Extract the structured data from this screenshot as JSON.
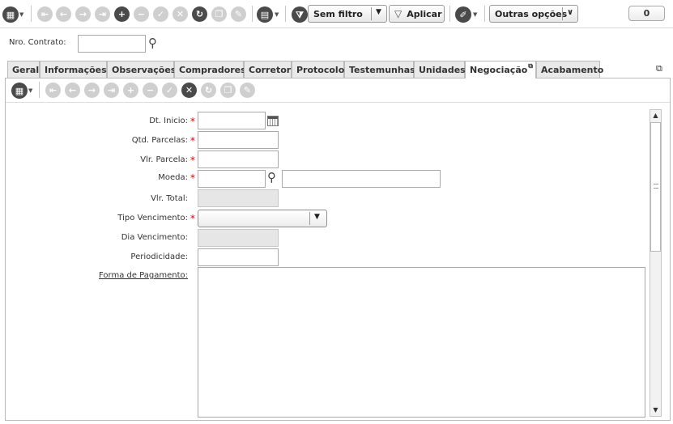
{
  "toolbar": {
    "filter_label": "Sem filtro",
    "apply_label": "Aplicar",
    "more_label": "Outras opções",
    "count_value": "0"
  },
  "contract": {
    "label": "Nro. Contrato:",
    "value": ""
  },
  "tabs": [
    {
      "label": "Geral"
    },
    {
      "label": "Informações"
    },
    {
      "label": "Observações"
    },
    {
      "label": "Compradores"
    },
    {
      "label": "Corretor"
    },
    {
      "label": "Protocolo"
    },
    {
      "label": "Testemunhas"
    },
    {
      "label": "Unidades"
    },
    {
      "label": "Negociação",
      "active": true
    },
    {
      "label": "Acabamento"
    }
  ],
  "form": {
    "dt_inicio": {
      "label": "Dt. Inicio:",
      "value": ""
    },
    "qtd_parcelas": {
      "label": "Qtd. Parcelas:",
      "value": ""
    },
    "vlr_parcela": {
      "label": "Vlr. Parcela:",
      "value": ""
    },
    "moeda": {
      "label": "Moeda:",
      "value": "",
      "description": ""
    },
    "vlr_total": {
      "label": "Vlr. Total:",
      "value": ""
    },
    "tipo_vencimento": {
      "label": "Tipo Vencimento:",
      "value": ""
    },
    "dia_vencimento": {
      "label": "Dia Vencimento:",
      "value": ""
    },
    "periodicidade": {
      "label": "Periodicidade:",
      "value": ""
    },
    "forma_pagamento": {
      "label": "Forma de Pagamento:",
      "value": ""
    }
  },
  "colors": {
    "required": "#dd0000",
    "tab_bg": "#e9e9e9",
    "border": "#bbbbbb"
  }
}
